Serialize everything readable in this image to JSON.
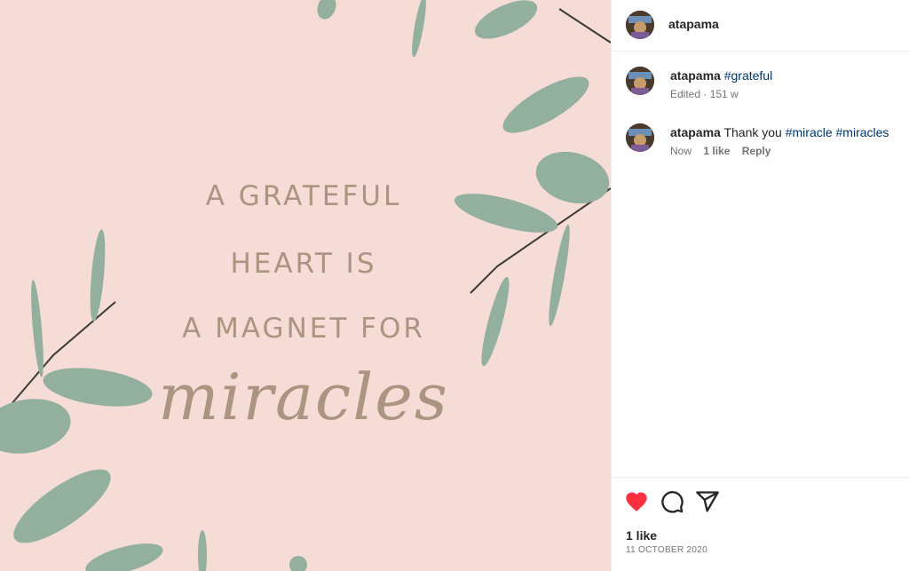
{
  "post": {
    "quote_lines": [
      "A GRATEFUL",
      "HEART IS",
      "A MAGNET FOR"
    ],
    "quote_script": "miracles",
    "colors": {
      "background": "#f5dcd7",
      "quote_text": "#a99580",
      "leaf": "#93b09e"
    }
  },
  "header": {
    "username": "atapama"
  },
  "comments": [
    {
      "user": "atapama",
      "text": "",
      "hashtags": [
        "#grateful"
      ],
      "meta": "Edited · 151 w",
      "likes": "",
      "reply": ""
    },
    {
      "user": "atapama",
      "text": "Thank you",
      "hashtags": [
        "#miracle",
        "#miracles"
      ],
      "meta": "Now",
      "likes": "1 like",
      "reply": "Reply"
    }
  ],
  "actions": {
    "liked": true,
    "like_icon": "heart-icon",
    "comment_icon": "comment-icon",
    "share_icon": "share-icon",
    "like_color": "#ff3040"
  },
  "likes_count": "1 like",
  "date": "11 OCTOBER 2020"
}
